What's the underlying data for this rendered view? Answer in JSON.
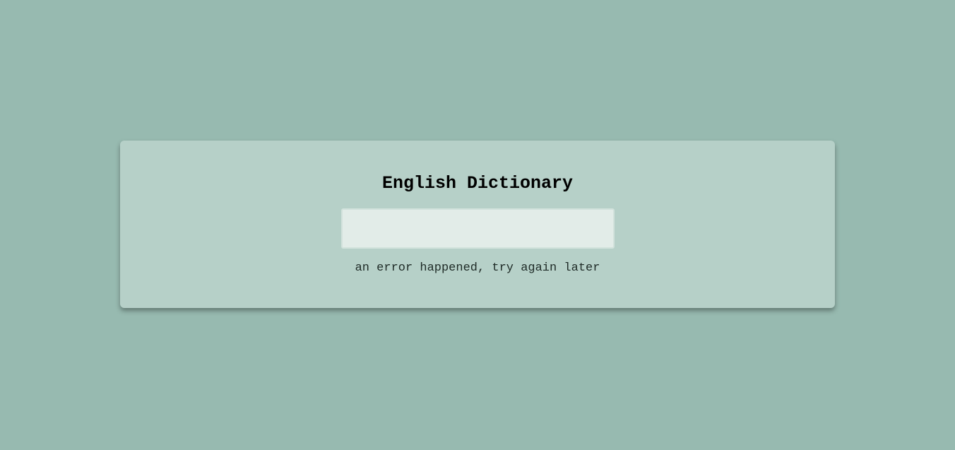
{
  "app": {
    "title": "English Dictionary"
  },
  "search": {
    "value": "",
    "placeholder": ""
  },
  "status": {
    "message": "an error happened, try again later"
  },
  "colors": {
    "page_background": "#97bab0",
    "card_background": "#b6d0c8",
    "input_background": "#e2ece8",
    "text": "#000000"
  }
}
